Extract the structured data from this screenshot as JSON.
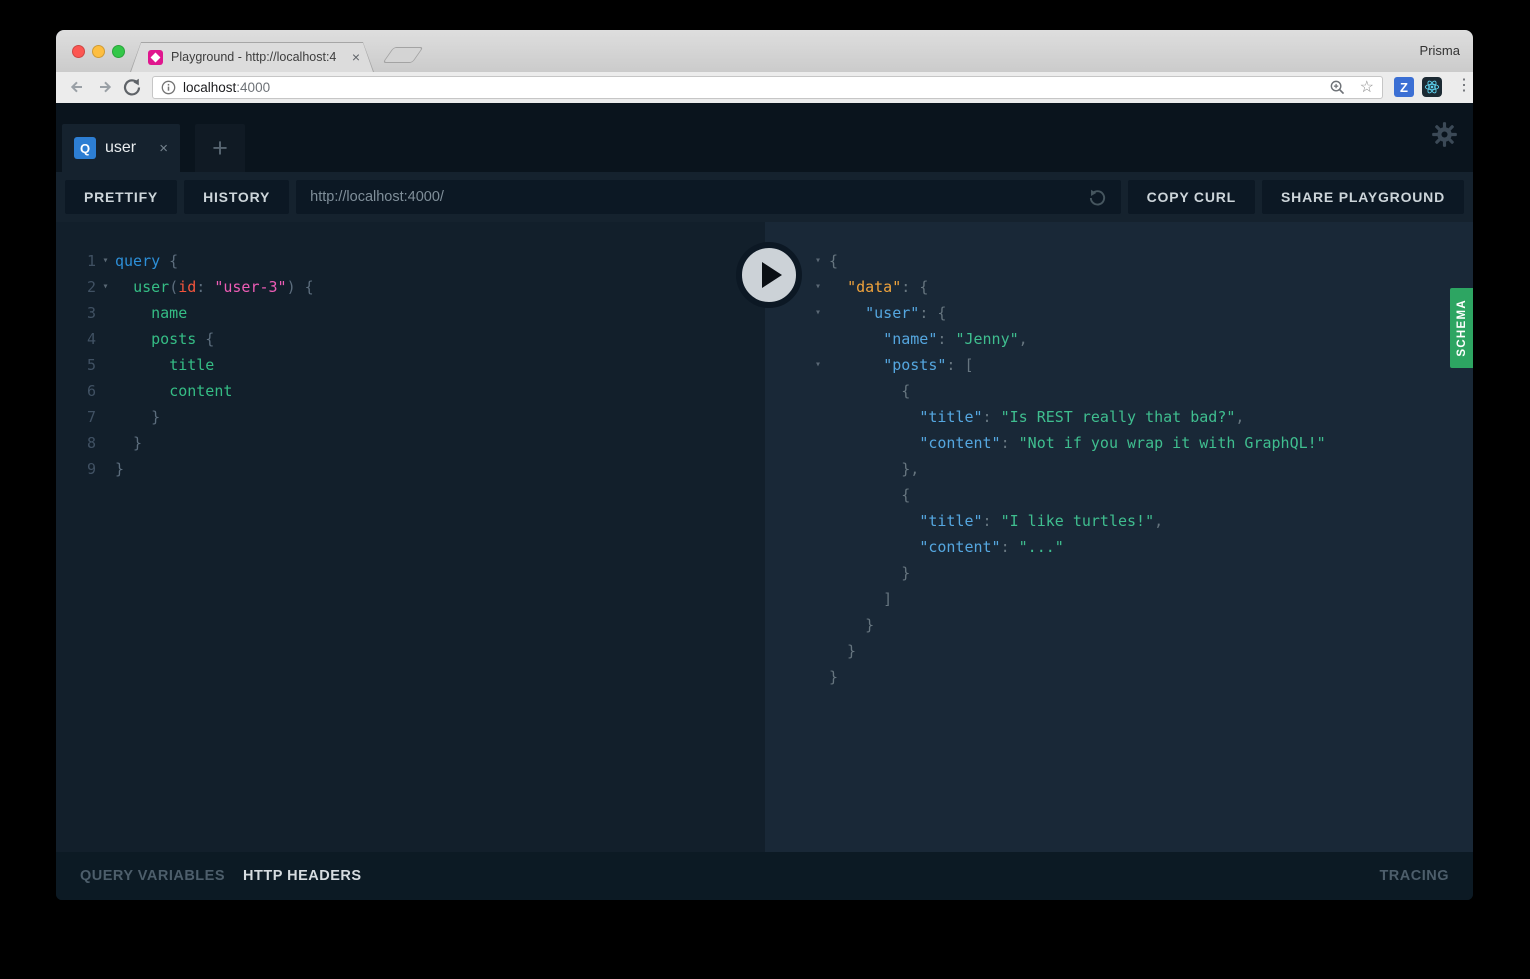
{
  "browser": {
    "profile": "Prisma",
    "tab": {
      "title": "Playground - http://localhost:4",
      "close": "×"
    },
    "url_host": "localhost",
    "url_port": ":4000",
    "extensions": {
      "z": "Z"
    },
    "menu_dots": "⋮",
    "star": "☆"
  },
  "playground": {
    "session_tab": {
      "badge": "Q",
      "title": "user",
      "close": "×"
    },
    "new_tab": "+",
    "toolbar": {
      "prettify": "PRETTIFY",
      "history": "HISTORY",
      "endpoint": "http://localhost:4000/",
      "copy_curl": "COPY CURL",
      "share_playground": "SHARE PLAYGROUND"
    },
    "schema_tab": "SCHEMA",
    "bottom_bar": {
      "query_variables": "QUERY VARIABLES",
      "http_headers": "HTTP HEADERS",
      "tracing": "TRACING"
    }
  },
  "colors": {
    "keyword": "#2d8fd8",
    "field": "#35bd85",
    "argument": "#f2543c",
    "string_pink": "#ed5cb5",
    "punct": "#5c6d7d",
    "line_number": "#405163",
    "fold_caret": "#5a6875",
    "resp_key": "#55a7e0",
    "resp_data_key": "#f0a33c",
    "resp_string": "#3fbe8f",
    "resp_punct": "#66757f",
    "schema_green": "#2da562",
    "q_badge_blue": "#2d7ed3"
  },
  "query_editor": {
    "lines": [
      {
        "n": "1",
        "fold": true,
        "tokens": [
          [
            "query",
            "keyword"
          ],
          [
            " {",
            "punct"
          ]
        ]
      },
      {
        "n": "2",
        "fold": true,
        "tokens": [
          [
            "  ",
            ""
          ],
          [
            "user",
            "field"
          ],
          [
            "(",
            "punct"
          ],
          [
            "id",
            "argument"
          ],
          [
            ": ",
            "punct"
          ],
          [
            "\"user-3\"",
            "string_pink"
          ],
          [
            ") {",
            "punct"
          ]
        ]
      },
      {
        "n": "3",
        "tokens": [
          [
            "    ",
            ""
          ],
          [
            "name",
            "field"
          ]
        ]
      },
      {
        "n": "4",
        "tokens": [
          [
            "    ",
            ""
          ],
          [
            "posts",
            "field"
          ],
          [
            " {",
            "punct"
          ]
        ]
      },
      {
        "n": "5",
        "tokens": [
          [
            "      ",
            ""
          ],
          [
            "title",
            "field"
          ]
        ]
      },
      {
        "n": "6",
        "tokens": [
          [
            "      ",
            ""
          ],
          [
            "content",
            "field"
          ]
        ]
      },
      {
        "n": "7",
        "tokens": [
          [
            "    }",
            "punct"
          ]
        ]
      },
      {
        "n": "8",
        "tokens": [
          [
            "  }",
            "punct"
          ]
        ]
      },
      {
        "n": "9",
        "tokens": [
          [
            "}",
            "punct"
          ]
        ]
      }
    ]
  },
  "response": {
    "lines": [
      {
        "fold": true,
        "tokens": [
          [
            "{",
            "resp_punct"
          ]
        ]
      },
      {
        "fold": true,
        "tokens": [
          [
            "  ",
            ""
          ],
          [
            "\"data\"",
            "resp_data_key"
          ],
          [
            ": ",
            "resp_punct"
          ],
          [
            "{",
            "resp_punct"
          ]
        ]
      },
      {
        "fold": true,
        "tokens": [
          [
            "    ",
            ""
          ],
          [
            "\"user\"",
            "resp_key"
          ],
          [
            ": ",
            "resp_punct"
          ],
          [
            "{",
            "resp_punct"
          ]
        ]
      },
      {
        "tokens": [
          [
            "      ",
            ""
          ],
          [
            "\"name\"",
            "resp_key"
          ],
          [
            ": ",
            "resp_punct"
          ],
          [
            "\"Jenny\"",
            "resp_string"
          ],
          [
            ",",
            "resp_punct"
          ]
        ]
      },
      {
        "fold": true,
        "tokens": [
          [
            "      ",
            ""
          ],
          [
            "\"posts\"",
            "resp_key"
          ],
          [
            ": ",
            "resp_punct"
          ],
          [
            "[",
            "resp_punct"
          ]
        ]
      },
      {
        "tokens": [
          [
            "        {",
            "resp_punct"
          ]
        ]
      },
      {
        "tokens": [
          [
            "          ",
            ""
          ],
          [
            "\"title\"",
            "resp_key"
          ],
          [
            ": ",
            "resp_punct"
          ],
          [
            "\"Is REST really that bad?\"",
            "resp_string"
          ],
          [
            ",",
            "resp_punct"
          ]
        ]
      },
      {
        "tokens": [
          [
            "          ",
            ""
          ],
          [
            "\"content\"",
            "resp_key"
          ],
          [
            ": ",
            "resp_punct"
          ],
          [
            "\"Not if you wrap it with GraphQL!\"",
            "resp_string"
          ]
        ]
      },
      {
        "tokens": [
          [
            "        },",
            "resp_punct"
          ]
        ]
      },
      {
        "tokens": [
          [
            "        {",
            "resp_punct"
          ]
        ]
      },
      {
        "tokens": [
          [
            "          ",
            ""
          ],
          [
            "\"title\"",
            "resp_key"
          ],
          [
            ": ",
            "resp_punct"
          ],
          [
            "\"I like turtles!\"",
            "resp_string"
          ],
          [
            ",",
            "resp_punct"
          ]
        ]
      },
      {
        "tokens": [
          [
            "          ",
            ""
          ],
          [
            "\"content\"",
            "resp_key"
          ],
          [
            ": ",
            "resp_punct"
          ],
          [
            "\"...\"",
            "resp_string"
          ]
        ]
      },
      {
        "tokens": [
          [
            "        }",
            "resp_punct"
          ]
        ]
      },
      {
        "tokens": [
          [
            "      ]",
            "resp_punct"
          ]
        ]
      },
      {
        "tokens": [
          [
            "    }",
            "resp_punct"
          ]
        ]
      },
      {
        "tokens": [
          [
            "  }",
            "resp_punct"
          ]
        ]
      },
      {
        "tokens": [
          [
            "}",
            "resp_punct"
          ]
        ]
      }
    ]
  }
}
